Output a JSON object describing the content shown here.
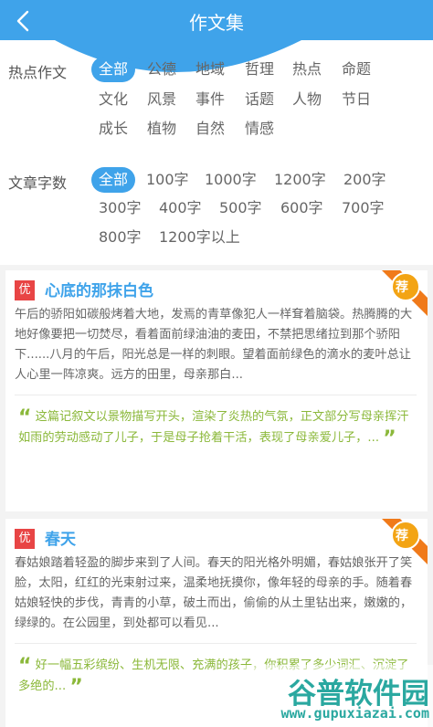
{
  "header": {
    "title": "作文集",
    "back_icon": "chevron-left-icon",
    "bg_color": "#3fa3ea"
  },
  "filters": {
    "hot": {
      "label": "热点作文",
      "options": [
        "全部",
        "公德",
        "地域",
        "哲理",
        "热点",
        "命题",
        "文化",
        "风景",
        "事件",
        "话题",
        "人物",
        "节日",
        "成长",
        "植物",
        "自然",
        "情感"
      ],
      "selected": "全部"
    },
    "words": {
      "label": "文章字数",
      "options": [
        "全部",
        "100字",
        "1000字",
        "1200字",
        "200字",
        "300字",
        "400字",
        "500字",
        "600字",
        "700字",
        "800字",
        "1200字以上"
      ],
      "selected": "全部"
    }
  },
  "articles": [
    {
      "badge": "优",
      "title": "心底的那抹白色",
      "ribbon_label": "荐",
      "excerpt": "午后的骄阳如碳般烤着大地，发焉的青草像犯人一样耷着脑袋。热腾腾的大地好像要把一切焚尽，看着面前绿油油的麦田，不禁把思绪拉到那个骄阳下......八月的午后，阳光总是一样的刺眼。望着面前绿色的滴水的麦叶总让人心里一阵凉爽。远方的田里，母亲那白...",
      "review": "这篇记叙文以景物描写开头，渲染了炎热的气氛，正文部分写母亲挥汗如雨的劳动感动了儿子，于是母子抢着干活，表现了母亲爱儿子，..."
    },
    {
      "badge": "优",
      "title": "春天",
      "ribbon_label": "荐",
      "excerpt": "春姑娘踏着轻盈的脚步来到了人间。春天的阳光格外明媚，春姑娘张开了笑脸，太阳，红红的光束射过来，温柔地抚摸你，像年轻的母亲的手。随着春姑娘轻快的步伐，青青的小草，破土而出，偷偷的从土里钻出来，嫩嫩的，绿绿的。在公园里，到处都可以看见...",
      "review": "好一幅五彩缤纷、生机无限、充满的孩子，你积累了多少词汇、沉淀了多绝的..."
    }
  ],
  "watermark": {
    "brand": "谷普软件园",
    "url": "www.gupuxiazai.com"
  }
}
